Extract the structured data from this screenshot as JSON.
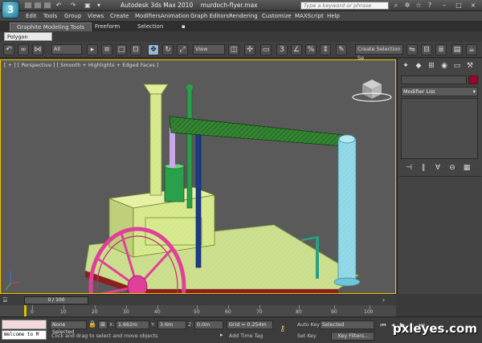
{
  "app": {
    "title": "Autodesk 3ds Max 2010",
    "filename": "murdoch-flyer.max",
    "search_placeholder": "Type a keyword or phrase"
  },
  "menu": [
    "Edit",
    "Tools",
    "Group",
    "Views",
    "Create",
    "Modifiers",
    "Animation",
    "Graph Editors",
    "Rendering",
    "Customize",
    "MAXScript",
    "Help"
  ],
  "ribbon": {
    "tabs": [
      "Graphite Modeling Tools",
      "Freeform",
      "Selection"
    ],
    "panel": "Polygon Modeling"
  },
  "toolbar": {
    "filter": "All",
    "coord_system": "View",
    "selection_set": "Create Selection Se"
  },
  "viewport": {
    "label": "[ + ] [ Perspective ] [ Smooth + Highlights + Edged Faces ]"
  },
  "command_panel": {
    "modifier_list": "Modifier List",
    "name_color": "#a2002a"
  },
  "timeline": {
    "slider": "0 / 100",
    "ticks": [
      "0",
      "10",
      "20",
      "30",
      "40",
      "50",
      "60",
      "70",
      "80",
      "90",
      "100"
    ]
  },
  "status": {
    "welcome": "Welcome to M",
    "selection": "None Selected",
    "prompt": "Click and drag to select and move objects",
    "x_label": "X:",
    "x_value": "1.662m",
    "y_label": "Y:",
    "y_value": "3.6m",
    "z_label": "Z:",
    "z_value": "0.0m",
    "grid": "Grid = 0.254m",
    "add_time_tag": "Add Time Tag",
    "auto_key": "Auto Key",
    "auto_key_value": "Selected",
    "set_key": "Set Key",
    "key_filters": "Key Filters..."
  },
  "watermark": "pxleyes.com",
  "colors": {
    "viewport_border": "#f7c400",
    "boiler": "#d4e88a",
    "wheel": "#e0409a",
    "beam": "#2a7a2a",
    "column": "#8ed6e6",
    "rod": "#1a3a8a"
  }
}
